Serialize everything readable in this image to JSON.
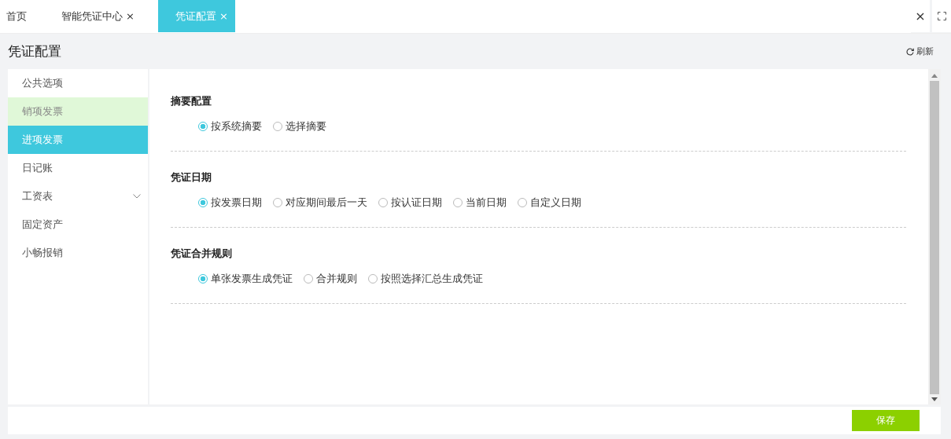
{
  "tabs": [
    {
      "label": "首页",
      "selected": false
    },
    {
      "label": "智能凭证中心",
      "close": "×",
      "selected": false
    },
    {
      "label": "凭证配置",
      "close": "×",
      "selected": true
    }
  ],
  "tab_bar_actions": {
    "close": "×"
  },
  "page": {
    "title": "凭证配置",
    "refresh": "刷新"
  },
  "sidebar": {
    "items": [
      {
        "label": "公共选项",
        "selected": false,
        "hovered": false,
        "expandable": false
      },
      {
        "label": "销项发票",
        "selected": false,
        "hovered": true,
        "expandable": false
      },
      {
        "label": "进项发票",
        "selected": true,
        "hovered": false,
        "expandable": false
      },
      {
        "label": "日记账",
        "selected": false,
        "hovered": false,
        "expandable": false
      },
      {
        "label": "工资表",
        "selected": false,
        "hovered": false,
        "expandable": true
      },
      {
        "label": "固定资产",
        "selected": false,
        "hovered": false,
        "expandable": false
      },
      {
        "label": "小畅报销",
        "selected": false,
        "hovered": false,
        "expandable": false
      }
    ]
  },
  "sections": [
    {
      "title": "摘要配置",
      "options": [
        {
          "label": "按系统摘要",
          "selected": true
        },
        {
          "label": "选择摘要",
          "selected": false
        }
      ]
    },
    {
      "title": "凭证日期",
      "options": [
        {
          "label": "按发票日期",
          "selected": true
        },
        {
          "label": "对应期间最后一天",
          "selected": false
        },
        {
          "label": "按认证日期",
          "selected": false
        },
        {
          "label": "当前日期",
          "selected": false
        },
        {
          "label": "自定义日期",
          "selected": false
        }
      ]
    },
    {
      "title": "凭证合并规则",
      "options": [
        {
          "label": "单张发票生成凭证",
          "selected": true
        },
        {
          "label": "合并规则",
          "selected": false
        },
        {
          "label": "按照选择汇总生成凭证",
          "selected": false
        }
      ]
    }
  ],
  "footer": {
    "save": "保存"
  }
}
